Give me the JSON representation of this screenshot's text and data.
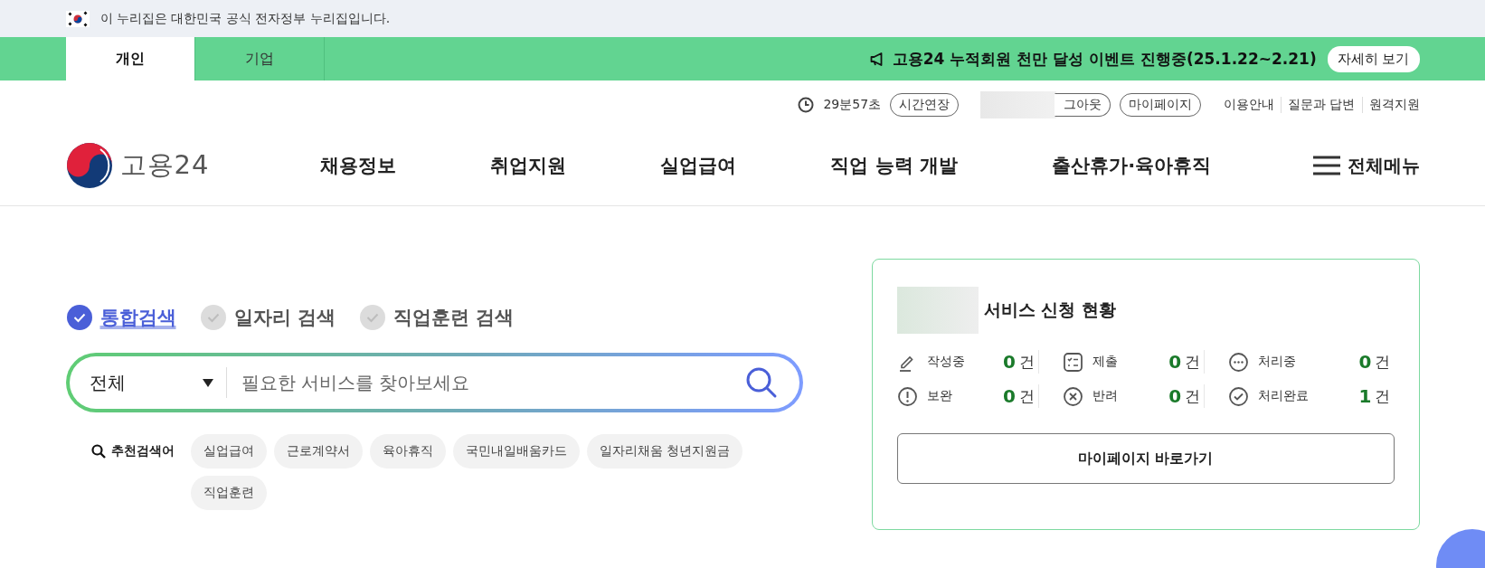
{
  "gov_banner": {
    "text": "이 누리집은 대한민국 공식 전자정부 누리집입니다."
  },
  "user_tabs": [
    {
      "label": "개인",
      "selected": true
    },
    {
      "label": "기업",
      "selected": false
    }
  ],
  "notice": {
    "text": "고용24 누적회원 천만 달성 이벤트 진행중(25.1.22~2.21)",
    "button": "자세히 보기"
  },
  "utility": {
    "timer": "29분57초",
    "extend_button": "시간연장",
    "logout_button": "그아웃",
    "mypage_button": "마이페이지",
    "links": [
      "이용안내",
      "질문과 답변",
      "원격지원"
    ]
  },
  "logo": {
    "text": "고용24"
  },
  "nav": [
    "채용정보",
    "취업지원",
    "실업급여",
    "직업 능력 개발",
    "출산휴가·육아휴직"
  ],
  "all_menu": "전체메뉴",
  "search": {
    "scopes": [
      {
        "label": "통합검색",
        "selected": true
      },
      {
        "label": "일자리 검색",
        "selected": false
      },
      {
        "label": "직업훈련 검색",
        "selected": false
      }
    ],
    "category": "전체",
    "placeholder": "필요한 서비스를 찾아보세요",
    "recommended_label": "추천검색어",
    "keywords": [
      "실업급여",
      "근로계약서",
      "육아휴직",
      "국민내일배움카드",
      "일자리채움 청년지원금",
      "직업훈련"
    ]
  },
  "status_card": {
    "title": "서비스 신청 현황",
    "items": [
      {
        "kind": "writing",
        "label": "작성중",
        "count": "0",
        "unit": "건"
      },
      {
        "kind": "submitted",
        "label": "제출",
        "count": "0",
        "unit": "건"
      },
      {
        "kind": "processing",
        "label": "처리중",
        "count": "0",
        "unit": "건"
      },
      {
        "kind": "supplement",
        "label": "보완",
        "count": "0",
        "unit": "건"
      },
      {
        "kind": "rejected",
        "label": "반려",
        "count": "0",
        "unit": "건"
      },
      {
        "kind": "done",
        "label": "처리완료",
        "count": "1",
        "unit": "건"
      }
    ],
    "button": "마이페이지 바로가기"
  }
}
